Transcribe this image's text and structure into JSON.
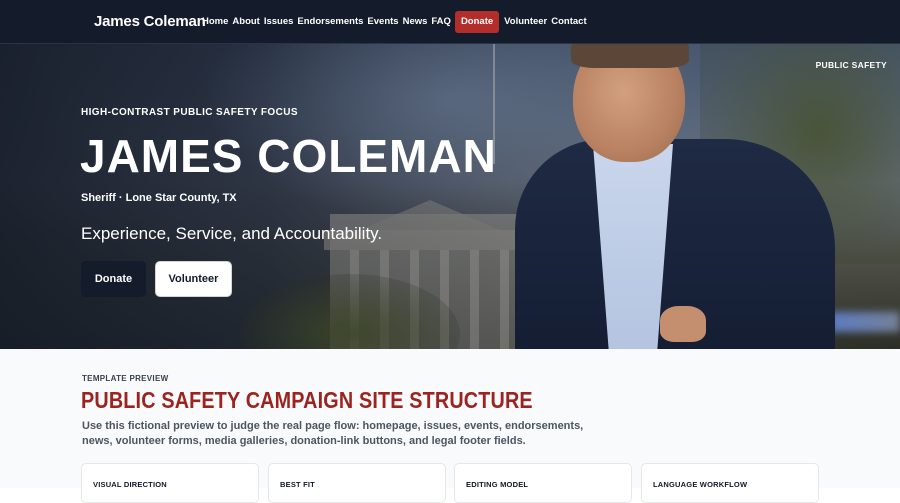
{
  "nav": {
    "brand": "James Coleman",
    "links": [
      "Home",
      "About",
      "Issues",
      "Endorsements",
      "Events",
      "News",
      "FAQ",
      "Donate",
      "Volunteer",
      "Contact"
    ]
  },
  "hero": {
    "tag": "PUBLIC SAFETY",
    "eyebrow": "HIGH-CONTRAST PUBLIC SAFETY FOCUS",
    "title": "JAMES COLEMAN",
    "role": "Sheriff · Lone Star County, TX",
    "slogan": "Experience, Service, and Accountability.",
    "donate_label": "Donate",
    "volunteer_label": "Volunteer"
  },
  "section": {
    "eyebrow": "TEMPLATE PREVIEW",
    "title": "PUBLIC SAFETY CAMPAIGN SITE STRUCTURE",
    "description": "Use this fictional preview to judge the real page flow: homepage, issues, events, endorsements, news, volunteer forms, media galleries, donation-link buttons, and legal footer fields.",
    "cards": [
      "VISUAL DIRECTION",
      "BEST FIT",
      "EDITING MODEL",
      "LANGUAGE WORKFLOW"
    ]
  },
  "colors": {
    "nav_bg": "#141b2b",
    "donate_accent": "#b32d2a",
    "section_title": "#9b2420"
  }
}
